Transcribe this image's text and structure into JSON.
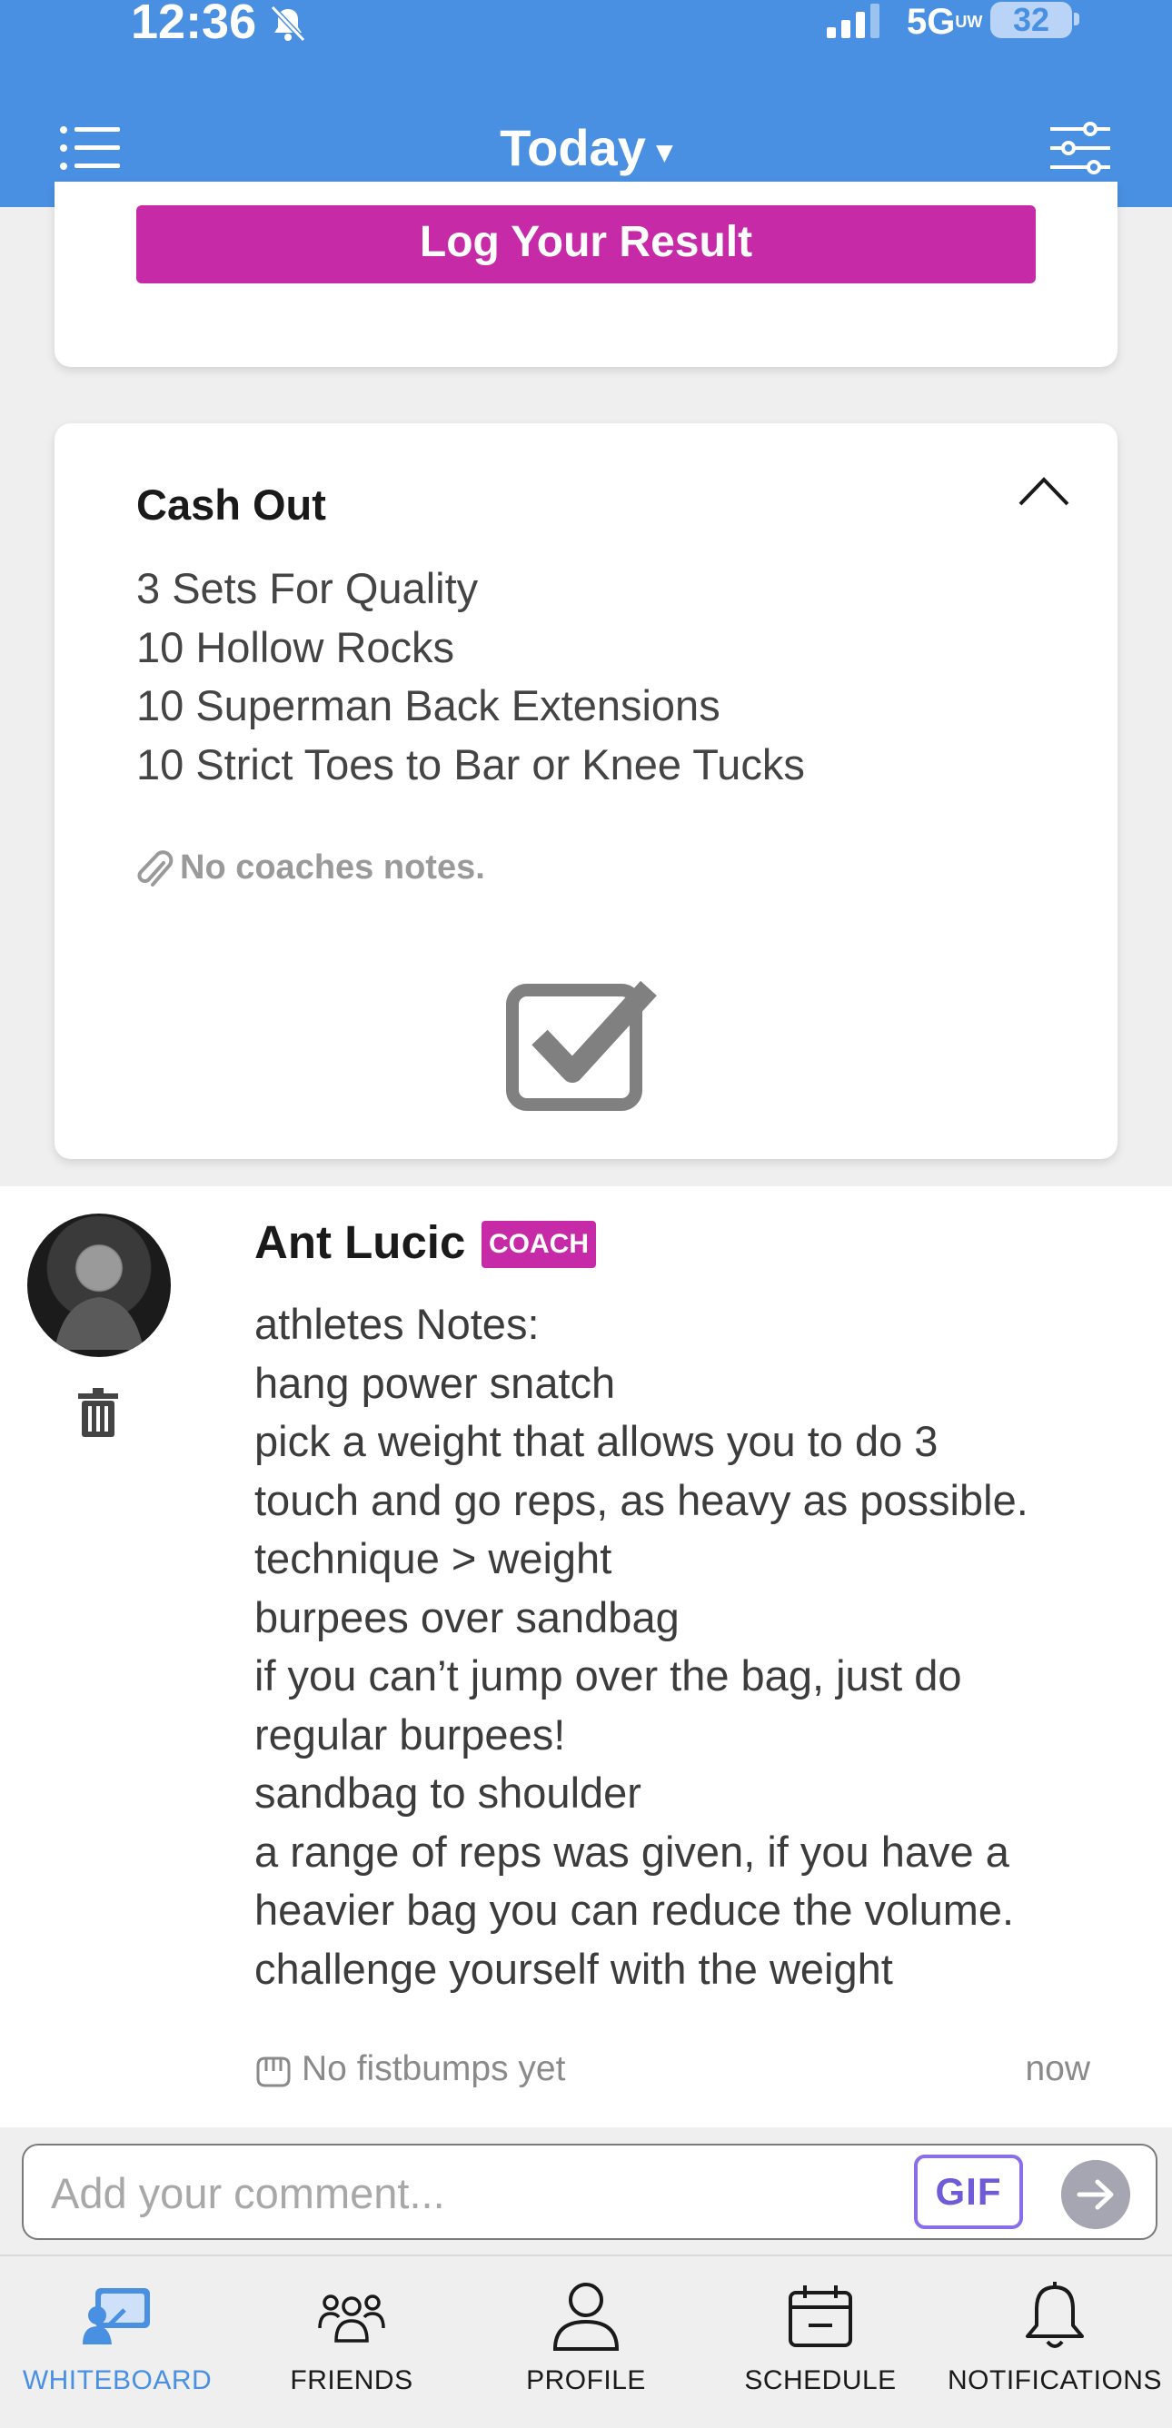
{
  "status_bar": {
    "time": "12:36",
    "network": "5G",
    "network_suffix": "UW",
    "battery": "32"
  },
  "header": {
    "title": "Today",
    "caret": "▾"
  },
  "workout_card": {
    "log_button": "Log Your Result"
  },
  "cash_out": {
    "title": "Cash Out",
    "lines": [
      "3 Sets For Quality",
      "10 Hollow Rocks",
      "10 Superman Back Extensions",
      "10 Strict Toes to Bar or Knee Tucks"
    ],
    "coach_notes": "No coaches notes."
  },
  "comment": {
    "author": "Ant Lucic",
    "badge": "COACH",
    "lines": [
      "athletes Notes:",
      "hang power snatch",
      "pick a weight that allows you to do 3",
      "touch and go reps, as heavy as possible.",
      "technique > weight",
      "burpees over sandbag",
      "if you can’t jump over the bag, just do",
      "regular burpees!",
      "sandbag to shoulder",
      "a range of reps was given, if you have a",
      "heavier bag you can reduce the volume.",
      "challenge yourself with the weight"
    ],
    "fistbumps": "No fistbumps yet",
    "timestamp": "now"
  },
  "composer": {
    "placeholder": "Add your comment...",
    "gif_label": "GIF"
  },
  "bottom_nav": {
    "items": [
      {
        "label": "WHITEBOARD",
        "icon": "whiteboard-icon",
        "active": true
      },
      {
        "label": "FRIENDS",
        "icon": "friends-icon",
        "active": false
      },
      {
        "label": "PROFILE",
        "icon": "profile-icon",
        "active": false
      },
      {
        "label": "SCHEDULE",
        "icon": "schedule-icon",
        "active": false
      },
      {
        "label": "NOTIFICATIONS",
        "icon": "bell-icon",
        "active": false
      }
    ]
  },
  "colors": {
    "header": "#4a90e2",
    "accent": "#c72aa6",
    "active_nav": "#4a90e2"
  }
}
